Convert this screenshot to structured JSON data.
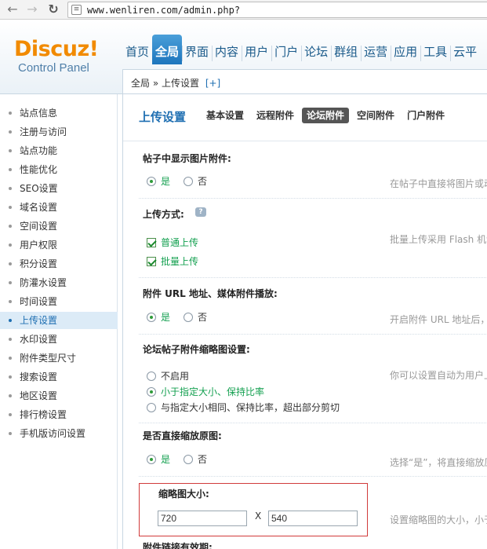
{
  "browser": {
    "url": "www.wenliren.com/admin.php?"
  },
  "header": {
    "logo_main": "Discuz!",
    "logo_sub": "Control Panel",
    "nav": [
      "首页",
      "全局",
      "界面",
      "内容",
      "用户",
      "门户",
      "论坛",
      "群组",
      "运营",
      "应用",
      "工具",
      "云平"
    ],
    "nav_active": "全局",
    "breadcrumb": "全局 » 上传设置",
    "breadcrumb_add": "[+]"
  },
  "sidebar": {
    "items": [
      "站点信息",
      "注册与访问",
      "站点功能",
      "性能优化",
      "SEO设置",
      "域名设置",
      "空间设置",
      "用户权限",
      "积分设置",
      "防灌水设置",
      "时间设置",
      "上传设置",
      "水印设置",
      "附件类型尺寸",
      "搜索设置",
      "地区设置",
      "排行榜设置",
      "手机版访问设置"
    ],
    "active": "上传设置"
  },
  "main": {
    "title": "上传设置",
    "tabs": [
      "基本设置",
      "远程附件",
      "论坛附件",
      "空间附件",
      "门户附件"
    ],
    "active_tab": "论坛附件",
    "settings": [
      {
        "title": "帖子中显示图片附件:",
        "tip": "在帖子中直接将图片或动",
        "options": [
          "是",
          "否"
        ],
        "selected": "是"
      },
      {
        "title": "上传方式:",
        "tip": "批量上传采用 Flash 机制",
        "options": [
          "普通上传",
          "批量上传"
        ],
        "checked": [
          "普通上传",
          "批量上传"
        ]
      },
      {
        "title": "附件 URL 地址、媒体附件播放:",
        "tip": "开启附件 URL 地址后，",
        "options": [
          "是",
          "否"
        ],
        "selected": "是"
      },
      {
        "title": "论坛帖子附件缩略图设置:",
        "tip": "你可以设置自动为用户上",
        "options": [
          "不启用",
          "小于指定大小、保持比率",
          "与指定大小相同、保持比率，超出部分剪切"
        ],
        "selected": "小于指定大小、保持比率"
      },
      {
        "title": "是否直接缩放原图:",
        "tip": "选择“是”，将直接缩放原",
        "options": [
          "是",
          "否"
        ],
        "selected": "是"
      },
      {
        "title": "缩略图大小:",
        "tip": "设置缩略图的大小，小于",
        "width": "720",
        "height": "540",
        "separator": "X"
      },
      {
        "title": "附件链接有效期:"
      }
    ]
  },
  "colors": {
    "accent": "#1f6fb2",
    "logo": "#f18a00",
    "selected_option": "#14a050",
    "highlight_border": "#d13a3a"
  }
}
